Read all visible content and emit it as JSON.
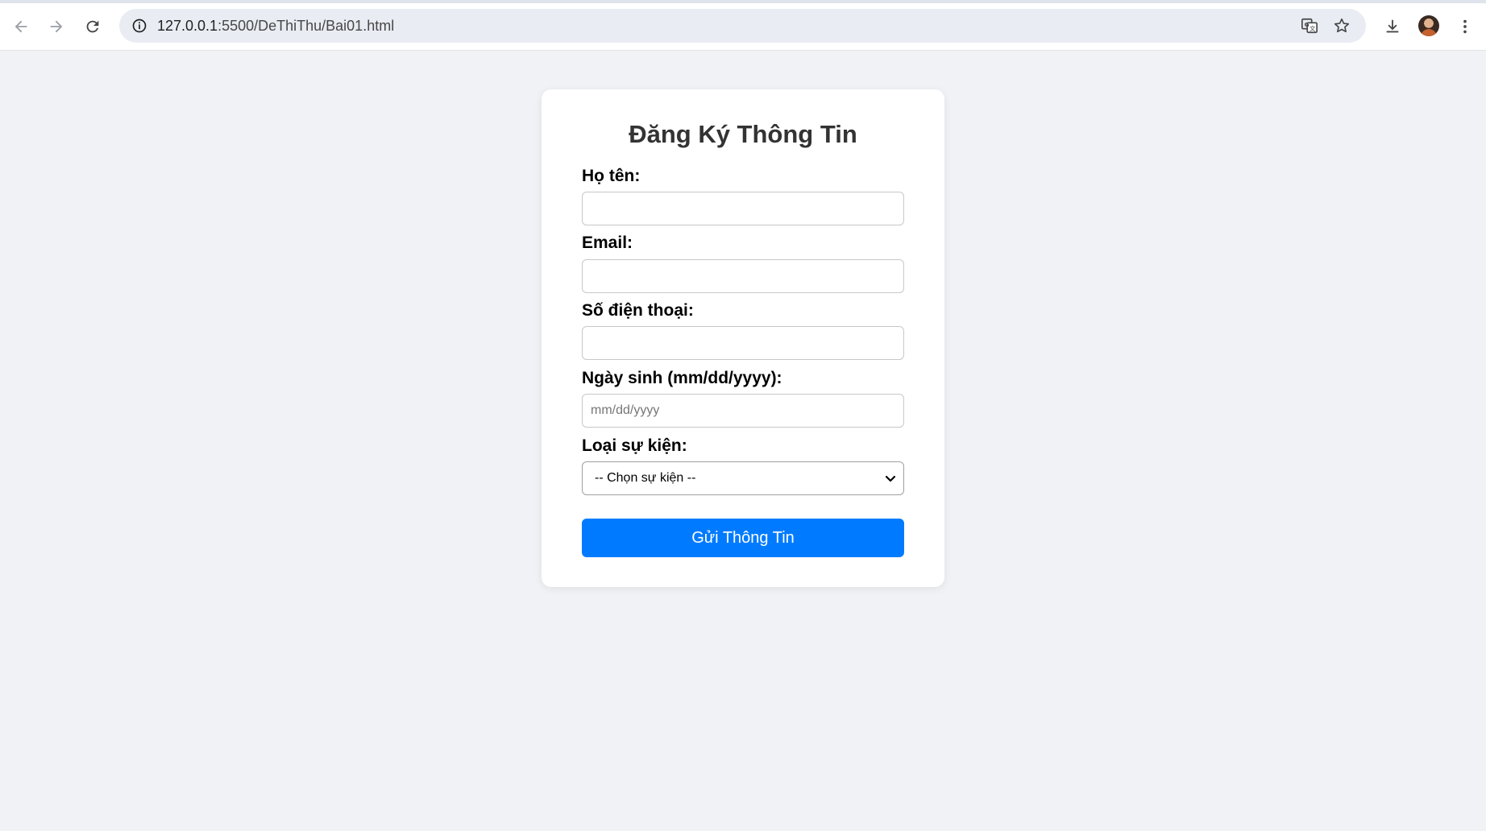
{
  "browser": {
    "url_host": "127.0.0.1",
    "url_rest": ":5500/DeThiThu/Bai01.html",
    "icons": {
      "back": "arrow-left-icon",
      "forward": "arrow-right-icon",
      "reload": "reload-icon",
      "site_info": "info-icon",
      "translate": "translate-icon",
      "bookmark": "star-icon",
      "download": "download-icon",
      "menu": "kebab-menu-icon"
    }
  },
  "form": {
    "title": "Đăng Ký Thông Tin",
    "name_label": "Họ tên:",
    "email_label": "Email:",
    "phone_label": "Số điện thoại:",
    "dob_label": "Ngày sinh (mm/dd/yyyy):",
    "dob_placeholder": "mm/dd/yyyy",
    "event_label": "Loại sự kiện:",
    "event_selected": "-- Chọn sự kiện --",
    "submit_label": "Gửi Thông Tin"
  },
  "colors": {
    "page_background": "#f0f2f5",
    "accent": "#007bff",
    "title": "#333333"
  }
}
